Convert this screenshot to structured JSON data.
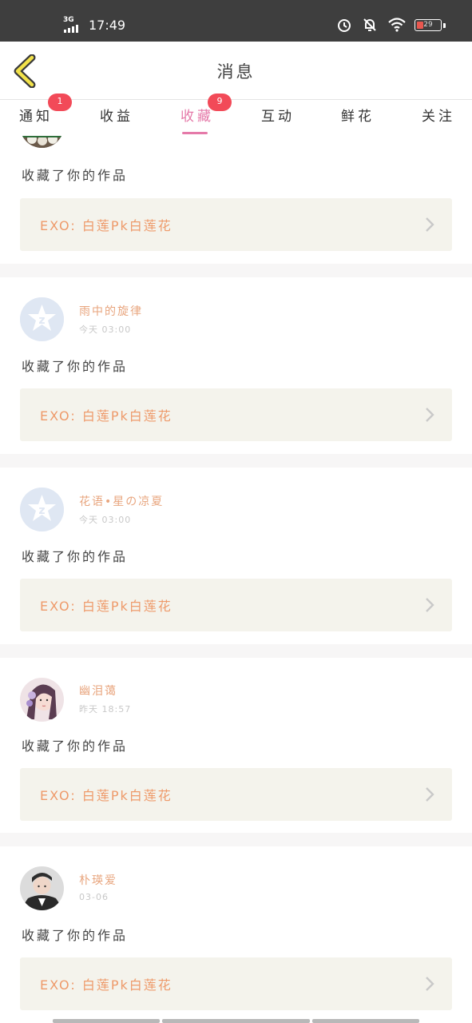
{
  "status": {
    "network": "3G",
    "time": "17:49",
    "battery": "29",
    "battery_level": 0.29,
    "icons": [
      "alarm-icon",
      "bell-off-icon",
      "wifi-icon",
      "battery-icon"
    ]
  },
  "header": {
    "title": "消息",
    "back_icon": "chevron-left-icon"
  },
  "tabs": [
    {
      "label": "通知",
      "badge": "1"
    },
    {
      "label": "收益"
    },
    {
      "label": "收藏",
      "badge": "9",
      "active": true
    },
    {
      "label": "互动"
    },
    {
      "label": "鲜花"
    },
    {
      "label": "关注"
    }
  ],
  "colors": {
    "accent": "#e57aa9",
    "badge": "#f24a58",
    "name": "#e8a57e",
    "work_text": "#ee9a6a",
    "work_bg": "#f4f3ec"
  },
  "items": [
    {
      "user": "",
      "time": "",
      "action": "收藏了你的作品",
      "work": "EXO:  白莲Pk白莲花",
      "avatar": "photo"
    },
    {
      "user": "雨中的旋律",
      "time": "今天 03:00",
      "action": "收藏了你的作品",
      "work": "EXO:  白莲Pk白莲花",
      "avatar": "default"
    },
    {
      "user": "花语•星の凉夏",
      "time": "今天 03:00",
      "action": "收藏了你的作品",
      "work": "EXO:  白莲Pk白莲花",
      "avatar": "default"
    },
    {
      "user": "幽泪蔼",
      "time": "昨天 18:57",
      "action": "收藏了你的作品",
      "work": "EXO:  白莲Pk白莲花",
      "avatar": "photo"
    },
    {
      "user": "朴瑛爱",
      "time": "03-06",
      "action": "收藏了你的作品",
      "work": "EXO:  白莲Pk白莲花",
      "avatar": "photo"
    }
  ]
}
